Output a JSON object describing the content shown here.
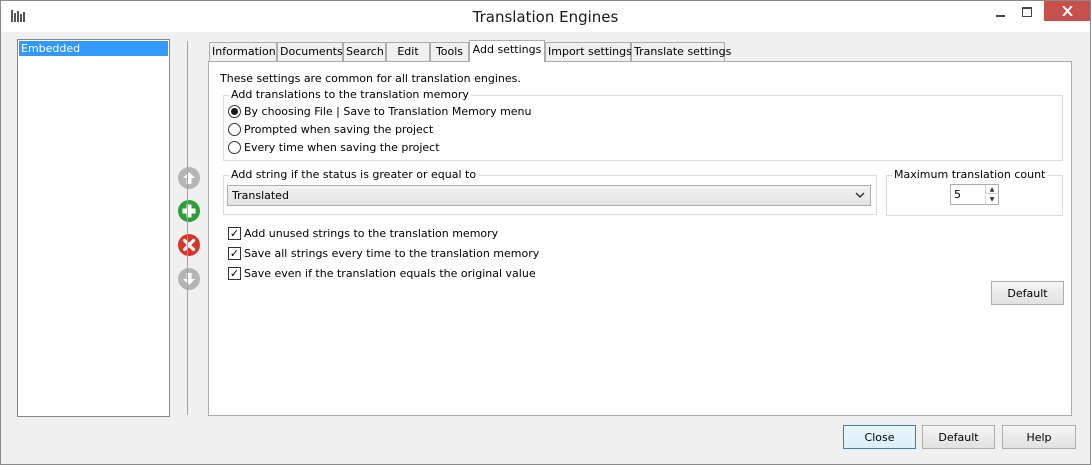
{
  "window": {
    "title": "Translation Engines"
  },
  "engine_list": {
    "items": [
      "Embedded"
    ],
    "selected": "Embedded"
  },
  "side_buttons": [
    "arrow-up-icon",
    "add-icon",
    "remove-icon",
    "arrow-down-icon"
  ],
  "tabs": [
    {
      "label": "Information"
    },
    {
      "label": "Documents"
    },
    {
      "label": "Search"
    },
    {
      "label": "Edit"
    },
    {
      "label": "Tools"
    },
    {
      "label": "Add settings"
    },
    {
      "label": "Import settings"
    },
    {
      "label": "Translate settings"
    }
  ],
  "active_tab": "Add settings",
  "panel": {
    "intro": "These settings are common for all translation engines.",
    "group_memory": {
      "title": "Add translations to the translation memory",
      "options": [
        {
          "label": "By choosing File | Save to Translation Memory menu",
          "checked": true
        },
        {
          "label": "Prompted when saving the project",
          "checked": false
        },
        {
          "label": "Every time when saving the project",
          "checked": false
        }
      ]
    },
    "group_status": {
      "title": "Add string if the status is greater or equal to",
      "value": "Translated"
    },
    "group_max": {
      "title": "Maximum translation count",
      "value": "5"
    },
    "checkboxes": [
      {
        "label": "Add unused strings to the translation memory",
        "checked": true
      },
      {
        "label": "Save all strings every time to the translation memory",
        "checked": true
      },
      {
        "label": "Save even if the translation equals the original value",
        "checked": true
      }
    ],
    "default_button": "Default"
  },
  "footer": {
    "close": "Close",
    "default": "Default",
    "help": "Help"
  },
  "colors": {
    "selection": "#3399ff",
    "close_button": "#c7504b",
    "add_icon": "#2e9e3a",
    "remove_icon": "#d9342b",
    "arrow_icon": "#b5b5b5"
  }
}
